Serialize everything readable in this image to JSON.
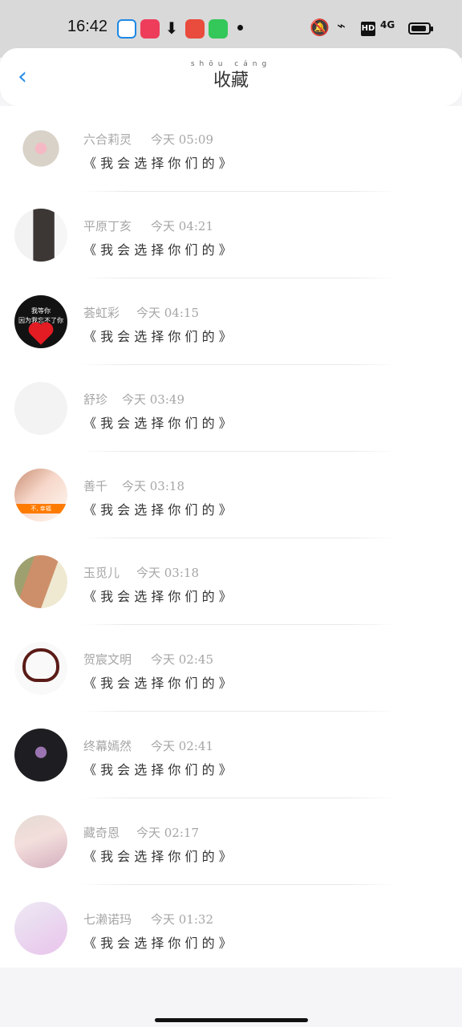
{
  "status": {
    "time": "16:42",
    "network": "4G"
  },
  "header": {
    "title": "收藏",
    "pinyin": "shōu cáng"
  },
  "list": {
    "items": [
      {
        "name": "六合莉灵",
        "time": "今天 05:09",
        "message": "《 我 会 选 择 你 们 的 》"
      },
      {
        "name": "平原丁亥",
        "time": "今天 04:21",
        "message": "《 我 会 选 择 你 们 的 》"
      },
      {
        "name": "荟虹彩",
        "time": "今天 04:15",
        "message": "《 我 会 选 择 你 们 的 》"
      },
      {
        "name": "舒珍",
        "time": "今天 03:49",
        "message": "《 我 会 选 择 你 们 的 》"
      },
      {
        "name": "善千",
        "time": "今天 03:18",
        "message": "《 我 会 选 择 你 们 的 》"
      },
      {
        "name": "玉觅儿",
        "time": "今天 03:18",
        "message": "《 我 会 选 择 你 们 的 》"
      },
      {
        "name": "贺宸文明",
        "time": "今天 02:45",
        "message": "《 我 会 选 择 你 们 的 》"
      },
      {
        "name": "终幕嫣然",
        "time": "今天 02:41",
        "message": "《 我 会 选 择 你 们 的 》"
      },
      {
        "name": "藏奇恩",
        "time": "今天 02:17",
        "message": "《 我 会 选 择 你 们 的 》"
      },
      {
        "name": "七濑诺玛",
        "time": "今天 01:32",
        "message": "《 我 会 选 择 你 们 的 》"
      }
    ]
  },
  "avatar_text": {
    "row3_line1": "我等你",
    "row3_line2": "因为我忘不了你",
    "row5_tag": "不, 幸福"
  }
}
